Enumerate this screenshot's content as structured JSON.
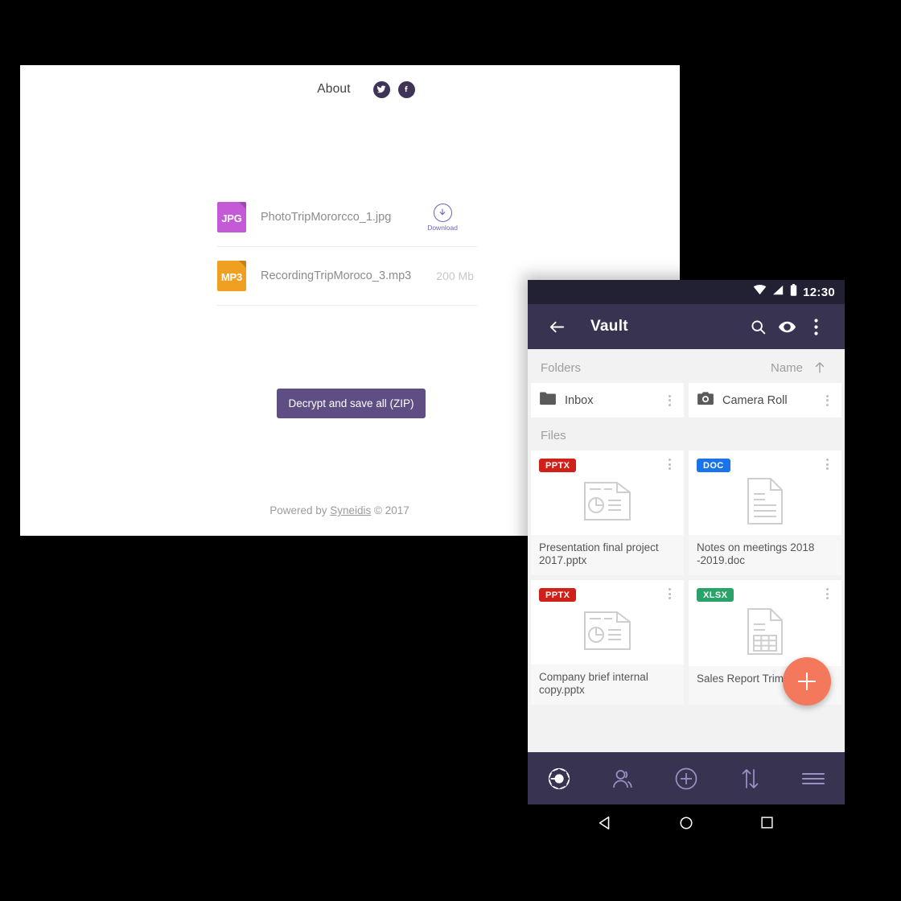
{
  "webpage": {
    "nav": {
      "about_label": "About",
      "twitter_icon": "twitter-icon",
      "facebook_icon": "facebook-icon"
    },
    "files": [
      {
        "type": "JPG",
        "name": "PhotoTripMororcco_1.jpg",
        "size": "",
        "action": "Download"
      },
      {
        "type": "MP3",
        "name": "RecordingTripMoroco_3.mp3",
        "size": "200 Mb",
        "action": ""
      }
    ],
    "decrypt_button": "Decrypt and save all (ZIP)",
    "footer": {
      "prefix": "Powered by ",
      "brand": "Syneidis",
      "suffix": " © 2017"
    },
    "colors": {
      "accent_purple": "#5e4e84",
      "download_blue": "#6f63b8",
      "jpg": "#c45ad6",
      "mp3": "#f0a020"
    }
  },
  "phone": {
    "statusbar": {
      "clock": "12:30",
      "wifi_icon": "wifi-icon",
      "signal_icon": "signal-icon",
      "battery_icon": "battery-icon"
    },
    "appbar": {
      "back_icon": "back-arrow-icon",
      "title": "Vault",
      "search_icon": "search-icon",
      "eye_icon": "eye-icon",
      "overflow_icon": "overflow-menu-icon"
    },
    "folders_section": {
      "title": "Folders",
      "sort_label": "Name",
      "sort_arrow_icon": "sort-ascending-icon",
      "items": [
        {
          "name": "Inbox",
          "icon": "folder-icon"
        },
        {
          "name": "Camera Roll",
          "icon": "camera-icon"
        }
      ]
    },
    "files_section": {
      "title": "Files",
      "items": [
        {
          "badge": "PPTX",
          "badge_class": "pptx",
          "icon": "presentation-file-icon",
          "name": "Presentation final project 2017.pptx"
        },
        {
          "badge": "DOC",
          "badge_class": "doc",
          "icon": "document-file-icon",
          "name": "Notes on meetings 2018 -2019.doc"
        },
        {
          "badge": "PPTX",
          "badge_class": "pptx",
          "icon": "presentation-file-icon",
          "name": "Company brief internal copy.pptx"
        },
        {
          "badge": "XLSX",
          "badge_class": "xlsx",
          "icon": "spreadsheet-file-icon",
          "name": "Sales Report Trim 1-2.xlsx"
        }
      ]
    },
    "fab": {
      "icon": "add-icon",
      "color": "#f4785c"
    },
    "bottom_nav": [
      {
        "icon": "vault-icon",
        "active": true
      },
      {
        "icon": "contacts-icon",
        "active": false
      },
      {
        "icon": "add-circle-icon",
        "active": false
      },
      {
        "icon": "sync-icon",
        "active": false
      },
      {
        "icon": "menu-icon",
        "active": false
      }
    ],
    "android_nav": [
      {
        "icon": "android-back-icon"
      },
      {
        "icon": "android-home-icon"
      },
      {
        "icon": "android-recents-icon"
      }
    ],
    "colors": {
      "appbar": "#393352",
      "statusbar": "#222033",
      "fab": "#f4785c"
    }
  }
}
